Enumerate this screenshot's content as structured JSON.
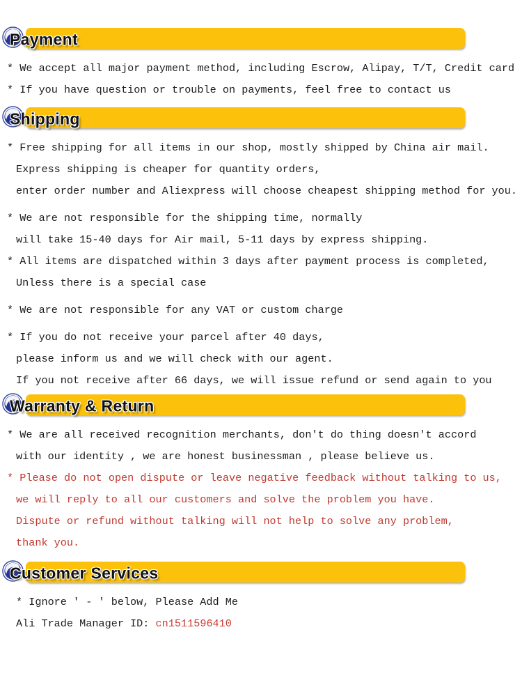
{
  "page": {
    "background_color": "#ffffff",
    "banner_color": "#fcc10a",
    "text_color": "#1c1c1c",
    "highlight_color": "#c0392f"
  },
  "sections": [
    {
      "id": "payment",
      "title": "Payment",
      "icon": "aliexpress-swirl-logo-icon",
      "lines": [
        {
          "text": "* We accept all major payment method, including Escrow, Alipay, T/T, Credit card",
          "style": "bullet"
        },
        {
          "text": "* If you have question or trouble on payments, feel free to contact us",
          "style": "bullet"
        }
      ]
    },
    {
      "id": "shipping",
      "title": "Shipping",
      "icon": "aliexpress-swirl-logo-icon",
      "lines": [
        {
          "text": "* Free shipping for all items in our shop, mostly shipped by China air mail.",
          "style": "bullet"
        },
        {
          "text": "Express shipping is cheaper for quantity orders,",
          "style": "indent"
        },
        {
          "text": "enter order number and Aliexpress will choose cheapest shipping method for you.",
          "style": "indent"
        },
        {
          "text": "* We are not responsible for the shipping time, normally",
          "style": "bullet-gap"
        },
        {
          "text": "will take 15-40 days for Air mail, 5-11 days by express shipping.",
          "style": "indent"
        },
        {
          "text": "* All items are dispatched within 3 days after payment process is completed,",
          "style": "bullet"
        },
        {
          "text": "Unless there is a special case",
          "style": "indent"
        },
        {
          "text": "* We are not responsible for any VAT or custom charge",
          "style": "bullet"
        },
        {
          "text": "* If you do not receive your parcel after 40 days,",
          "style": "bullet-gap"
        },
        {
          "text": "please inform us and we will check with our agent.",
          "style": "indent"
        },
        {
          "text": "If you not receive after 66 days, we will issue refund or send again to you",
          "style": "indent"
        }
      ]
    },
    {
      "id": "warranty",
      "title": "Warranty & Return",
      "icon": "aliexpress-swirl-logo-icon",
      "lines": [
        {
          "text": "* We are all received recognition merchants, don't do thing doesn't accord",
          "style": "bullet"
        },
        {
          "text": "with our identity , we are honest businessman , please believe us.",
          "style": "indent"
        },
        {
          "text": "* Please do not open dispute or leave negative feedback without talking to us,",
          "style": "bullet-red"
        },
        {
          "text": "we will reply to all our customers and solve the problem you have.",
          "style": "indent-red"
        },
        {
          "text": "Dispute or refund without talking will not help to solve any problem,",
          "style": "indent-red"
        },
        {
          "text": "thank you.",
          "style": "indent-red"
        }
      ]
    },
    {
      "id": "customer-services",
      "title": "Customer Services",
      "icon": "aliexpress-swirl-logo-icon",
      "lines": [
        {
          "text": "* Ignore ' - ' below, Please Add Me",
          "style": "bullet-gap-indent"
        }
      ],
      "contact": {
        "label": "Ali Trade Manager ID:",
        "value": "cn1511596410"
      }
    }
  ]
}
